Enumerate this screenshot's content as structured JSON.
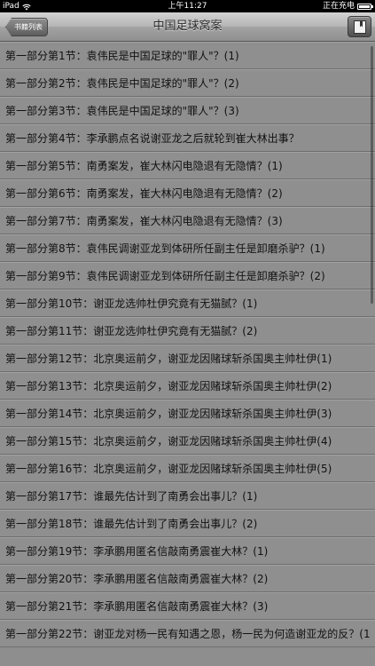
{
  "status_bar": {
    "carrier": "iPad",
    "time": "上午11:27",
    "battery_label": "正在充电",
    "icons": [
      "wifi-icon",
      "battery-icon"
    ]
  },
  "nav": {
    "back_label": "书籍列表",
    "title": "中国足球窝案",
    "bookmark_icon": "bookmark-icon"
  },
  "chapters": [
    "第一部分第1节：袁伟民是中国足球的\"罪人\"？(1)",
    "第一部分第2节：袁伟民是中国足球的\"罪人\"？(2)",
    "第一部分第3节：袁伟民是中国足球的\"罪人\"？(3)",
    "第一部分第4节：李承鹏点名说谢亚龙之后就轮到崔大林出事？",
    "第一部分第5节：南勇案发，崔大林闪电隐退有无隐情？(1)",
    "第一部分第6节：南勇案发，崔大林闪电隐退有无隐情？(2)",
    "第一部分第7节：南勇案发，崔大林闪电隐退有无隐情？(3)",
    "第一部分第8节：袁伟民调谢亚龙到体研所任副主任是卸磨杀驴？(1)",
    "第一部分第9节：袁伟民调谢亚龙到体研所任副主任是卸磨杀驴？(2)",
    "第一部分第10节：谢亚龙选帅杜伊究竟有无猫腻？(1)",
    "第一部分第11节：谢亚龙选帅杜伊究竟有无猫腻？(2)",
    "第一部分第12节：北京奥运前夕，谢亚龙因赌球斩杀国奥主帅杜伊(1)",
    "第一部分第13节：北京奥运前夕，谢亚龙因赌球斩杀国奥主帅杜伊(2)",
    "第一部分第14节：北京奥运前夕，谢亚龙因赌球斩杀国奥主帅杜伊(3)",
    "第一部分第15节：北京奥运前夕，谢亚龙因赌球斩杀国奥主帅杜伊(4)",
    "第一部分第16节：北京奥运前夕，谢亚龙因赌球斩杀国奥主帅杜伊(5)",
    "第一部分第17节：谁最先估计到了南勇会出事儿？(1)",
    "第一部分第18节：谁最先估计到了南勇会出事儿？(2)",
    "第一部分第19节：李承鹏用匿名信敲南勇震崔大林？(1)",
    "第一部分第20节：李承鹏用匿名信敲南勇震崔大林？(2)",
    "第一部分第21节：李承鹏用匿名信敲南勇震崔大林？(3)",
    "第一部分第22节：谢亚龙对杨一民有知遇之恩，杨一民为何造谢亚龙的反？(1"
  ]
}
